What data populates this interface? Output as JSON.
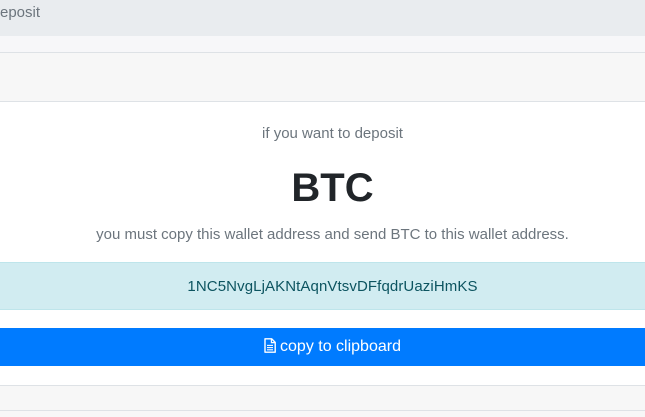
{
  "breadcrumb": {
    "current": "eposit"
  },
  "deposit": {
    "intro": "if you want to deposit",
    "currency": "BTC",
    "instruction": "you must copy this wallet address and send BTC to this wallet address.",
    "wallet_address": "1NC5NvgLjAKNtAqnVtsvDFfqdrUaziHmKS",
    "copy_button_label": "copy to clipboard",
    "copy_button_icon": "file-text-icon"
  },
  "colors": {
    "primary": "#007bff",
    "info_bg": "#d1ecf1",
    "info_text": "#0c5460",
    "muted_text": "#6c757d",
    "heading_text": "#212529"
  }
}
